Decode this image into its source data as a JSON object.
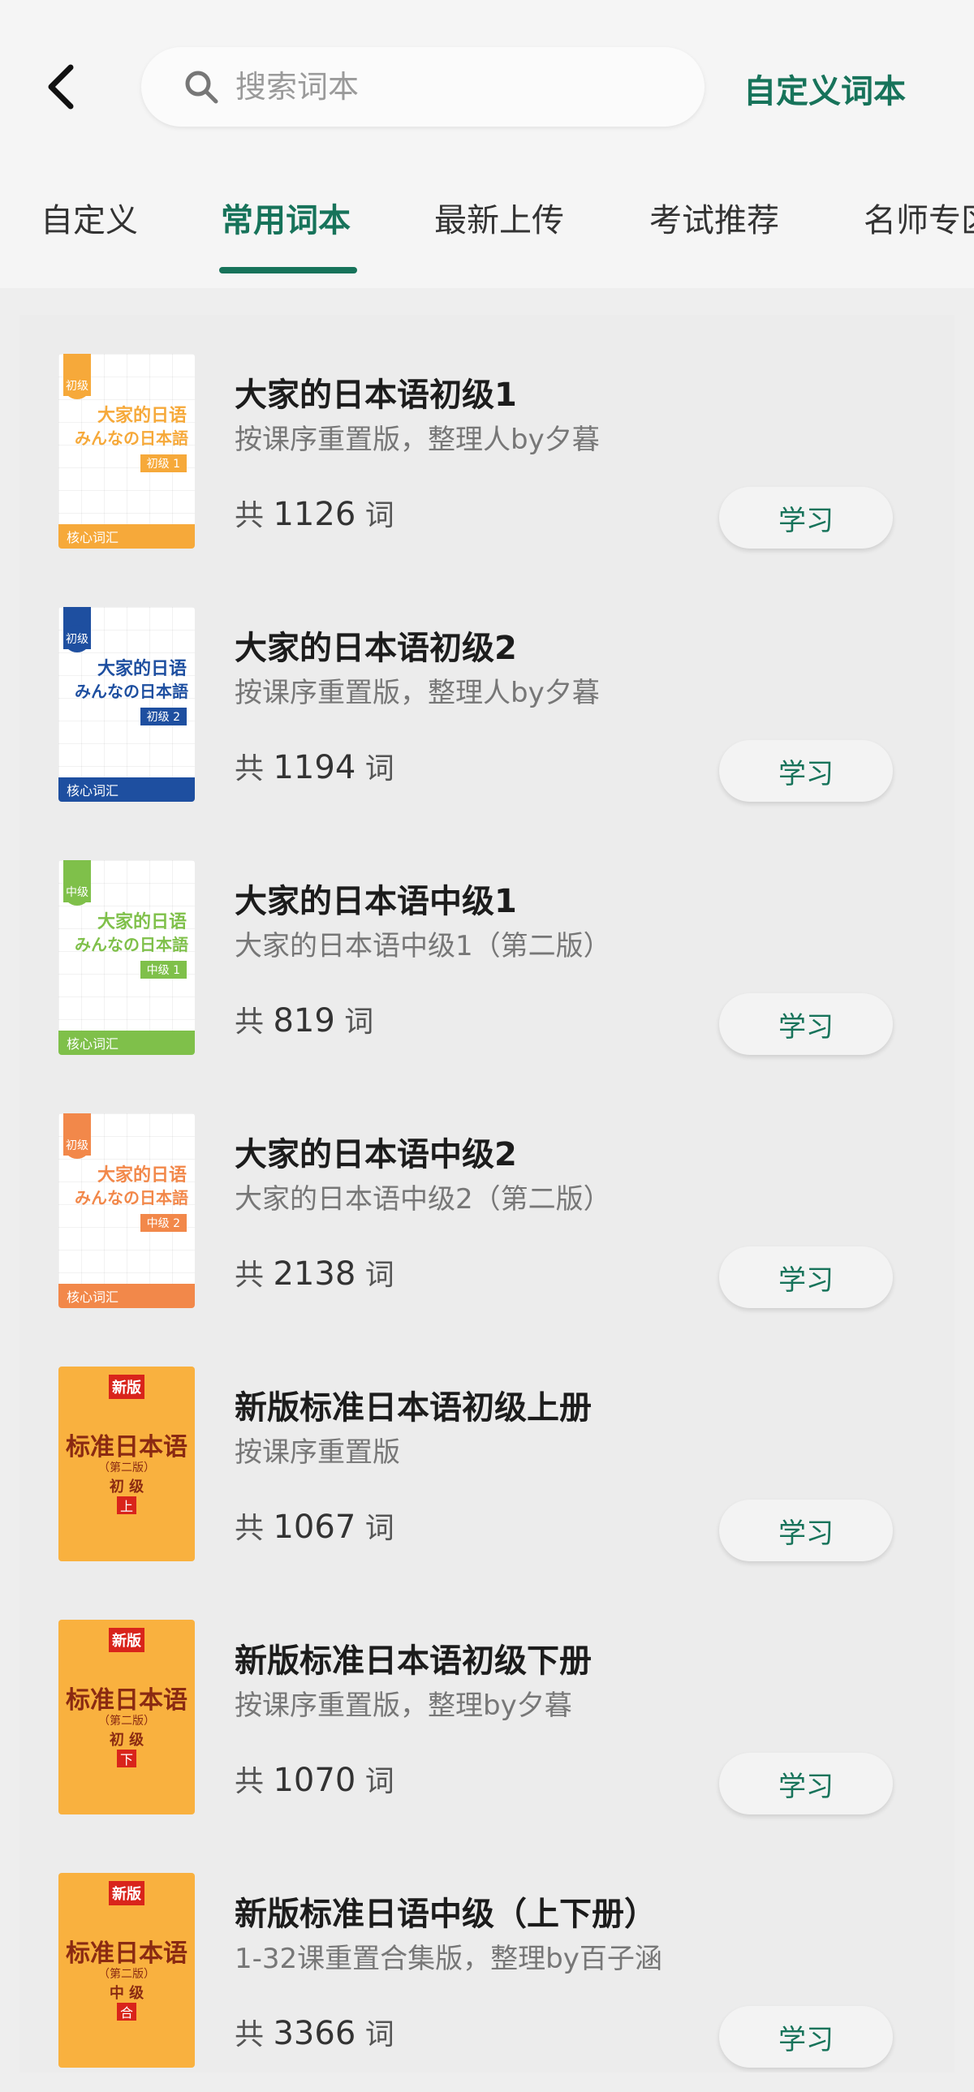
{
  "header": {
    "search_placeholder": "搜索词本",
    "custom_link": "自定义词本"
  },
  "tabs": [
    {
      "label": "自定义"
    },
    {
      "label": "常用词本"
    },
    {
      "label": "最新上传"
    },
    {
      "label": "考试推荐"
    },
    {
      "label": "名师专区"
    }
  ],
  "books": [
    {
      "title": "大家的日本语初级1",
      "subtitle": "按课序重置版，整理人by夕暮",
      "prefix": "共",
      "count": "1126",
      "unit": "词",
      "button": "学习",
      "cover": {
        "style": "white",
        "color": "#f6a93a",
        "badge": "初级",
        "line1": "大家的日语",
        "line2": "みんなの日本語",
        "level": "初级 1",
        "bottom": "核心词汇"
      }
    },
    {
      "title": "大家的日本语初级2",
      "subtitle": "按课序重置版，整理人by夕暮",
      "prefix": "共",
      "count": "1194",
      "unit": "词",
      "button": "学习",
      "cover": {
        "style": "white",
        "color": "#1e4fa0",
        "badge": "初级",
        "line1": "大家的日语",
        "line2": "みんなの日本語",
        "level": "初级 2",
        "bottom": "核心词汇"
      }
    },
    {
      "title": "大家的日本语中级1",
      "subtitle": "大家的日本语中级1（第二版）",
      "prefix": "共",
      "count": "819",
      "unit": "词",
      "button": "学习",
      "cover": {
        "style": "white",
        "color": "#7fc04a",
        "badge": "中级",
        "line1": "大家的日语",
        "line2": "みんなの日本語",
        "level": "中级 1",
        "bottom": "核心词汇"
      }
    },
    {
      "title": "大家的日本语中级2",
      "subtitle": "大家的日本语中级2（第二版）",
      "prefix": "共",
      "count": "2138",
      "unit": "词",
      "button": "学习",
      "cover": {
        "style": "white",
        "color": "#f2884a",
        "badge": "初级",
        "line1": "大家的日语",
        "line2": "みんなの日本語",
        "level": "中级 2",
        "bottom": "核心词汇"
      }
    },
    {
      "title": "新版标准日本语初级上册",
      "subtitle": "按课序重置版",
      "prefix": "共",
      "count": "1067",
      "unit": "词",
      "button": "学习",
      "cover": {
        "style": "orange",
        "tag": "新版",
        "main": "标准日本语",
        "edition": "（第二版）",
        "level": "初 级",
        "box": "上"
      }
    },
    {
      "title": "新版标准日本语初级下册",
      "subtitle": "按课序重置版，整理by夕暮",
      "prefix": "共",
      "count": "1070",
      "unit": "词",
      "button": "学习",
      "cover": {
        "style": "orange",
        "tag": "新版",
        "main": "标准日本语",
        "edition": "（第二版）",
        "level": "初 级",
        "box": "下"
      }
    },
    {
      "title": "新版标准日语中级（上下册）",
      "subtitle": "1-32课重置合集版，整理by百子涵",
      "prefix": "共",
      "count": "3366",
      "unit": "词",
      "button": "学习",
      "cover": {
        "style": "orange",
        "tag": "新版",
        "main": "标准日本语",
        "edition": "（第二版）",
        "level": "中 级",
        "box": "合"
      }
    }
  ],
  "colors": {
    "accent": "#17735a",
    "background": "#eeeeee"
  }
}
